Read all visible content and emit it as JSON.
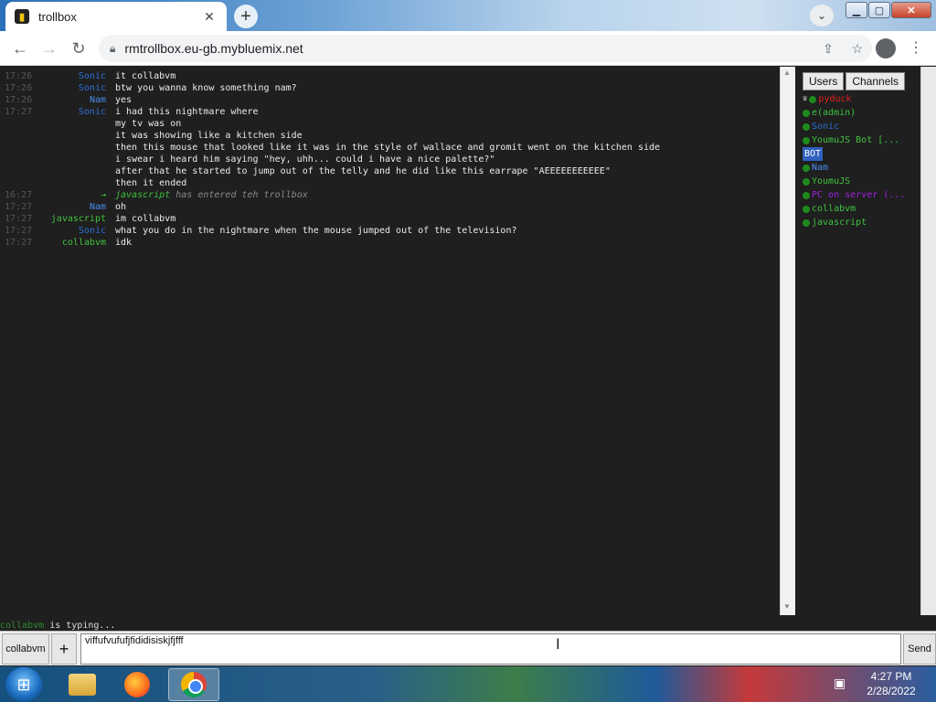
{
  "browser": {
    "tab_title": "trollbox",
    "tab_close": "✕",
    "new_tab": "+",
    "url": "rmtrollbox.eu-gb.mybluemix.net"
  },
  "chat": {
    "lines": [
      {
        "time": "17:26",
        "nick": "Sonic",
        "nick_color": "#2b6fd6",
        "text": "it collabvm"
      },
      {
        "time": "17:26",
        "nick": "Sonic",
        "nick_color": "#2b6fd6",
        "text": "btw you wanna know something nam?"
      },
      {
        "time": "17:26",
        "nick": "Nam",
        "nick_color": "#4a8cf0",
        "text": "yes"
      },
      {
        "time": "17:27",
        "nick": "Sonic",
        "nick_color": "#2b6fd6",
        "text": "i had this nightmare where"
      },
      {
        "time": "",
        "nick": "",
        "nick_color": "#2b6fd6",
        "text": "my tv was on"
      },
      {
        "time": "",
        "nick": "",
        "nick_color": "#2b6fd6",
        "text": "it was showing like a kitchen side"
      },
      {
        "time": "",
        "nick": "",
        "nick_color": "#2b6fd6",
        "text": "then this mouse that looked like it was in the style of wallace and gromit went on the kitchen side"
      },
      {
        "time": "",
        "nick": "",
        "nick_color": "#2b6fd6",
        "text": "i swear i heard him saying \"hey, uhh... could i have a nice palette?\""
      },
      {
        "time": "",
        "nick": "",
        "nick_color": "#2b6fd6",
        "text": "after that he started to jump out of the telly and he did like this earrape \"AEEEEEEEEEEE\""
      },
      {
        "time": "",
        "nick": "",
        "nick_color": "#2b6fd6",
        "text": "then it ended"
      },
      {
        "time": "16:27",
        "nick": "→",
        "nick_color": "#3ec23e",
        "system": true,
        "sys_nick": "javascript",
        "text": "has entered teh trollbox"
      },
      {
        "time": "17:27",
        "nick": "Nam",
        "nick_color": "#4a8cf0",
        "text": "oh"
      },
      {
        "time": "17:27",
        "nick": "javascript",
        "nick_color": "#3ec23e",
        "text": "im collabvm"
      },
      {
        "time": "17:27",
        "nick": "Sonic",
        "nick_color": "#2b6fd6",
        "text": "what you do in the nightmare when the mouse jumped out of the television?"
      },
      {
        "time": "17:27",
        "nick": "collabvm",
        "nick_color": "#3ec23e",
        "text": "idk"
      }
    ],
    "typing_user": "collabvm",
    "typing_text": " is typing..."
  },
  "sidebar": {
    "tab_users": "Users",
    "tab_channels": "Channels",
    "users": [
      {
        "name": "pyduck",
        "color": "#e02020",
        "crown": true
      },
      {
        "name": "e(admin)",
        "color": "#3ec23e"
      },
      {
        "name": "Sonic",
        "color": "#2b6fd6"
      },
      {
        "name": "YoumuJS Bot [...",
        "color": "#3ec23e"
      },
      {
        "name": "BOT",
        "color": "#ffffff",
        "badge": true,
        "no_dot": true
      },
      {
        "name": "Nam",
        "color": "#4a8cf0"
      },
      {
        "name": "YoumuJS",
        "color": "#3ec23e"
      },
      {
        "name": "PC on server (...",
        "color": "#a020e0"
      },
      {
        "name": "collabvm",
        "color": "#3ec23e"
      },
      {
        "name": "javascript",
        "color": "#3ec23e"
      }
    ]
  },
  "input": {
    "nick_label": "collabvm",
    "plus_label": "+",
    "value": "viffufvufufjfididisiskjfjfff",
    "send_label": "Send"
  },
  "taskbar": {
    "time": "4:27 PM",
    "date": "2/28/2022"
  }
}
